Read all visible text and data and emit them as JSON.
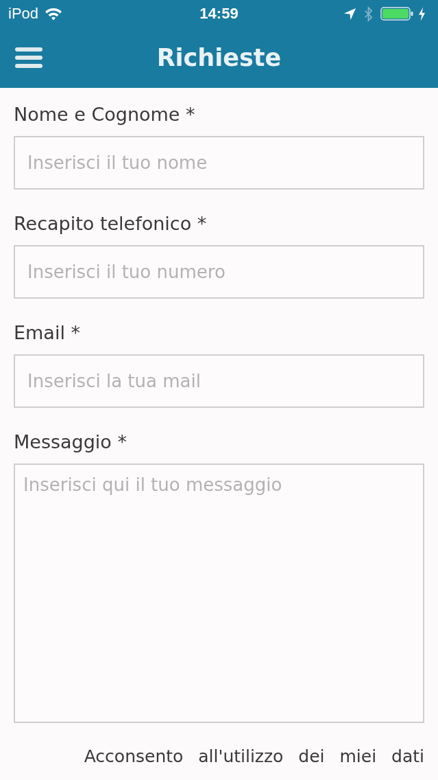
{
  "status_bar": {
    "carrier": "iPod",
    "time": "14:59"
  },
  "header": {
    "title": "Richieste"
  },
  "form": {
    "fields": [
      {
        "kind": "text",
        "label": "Nome e Cognome *",
        "placeholder": "Inserisci il tuo nome"
      },
      {
        "kind": "text",
        "label": "Recapito telefonico *",
        "placeholder": "Inserisci il tuo numero"
      },
      {
        "kind": "text",
        "label": "Email *",
        "placeholder": "Inserisci la tua mail"
      },
      {
        "kind": "textarea",
        "label": "Messaggio *",
        "placeholder": "Inserisci qui il tuo messaggio"
      }
    ]
  },
  "consent": {
    "text": "Acconsento all'utilizzo dei miei dati"
  }
}
